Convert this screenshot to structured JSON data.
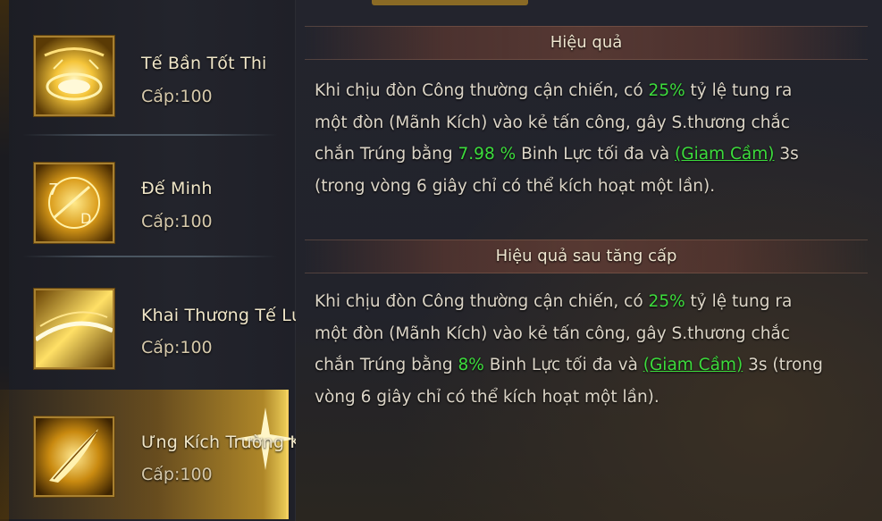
{
  "skills": [
    {
      "name": "Tế Bần Tốt Thi",
      "level": "Cấp:100",
      "icon": "golden-vortex-icon"
    },
    {
      "name": "Đế Minh",
      "level": "Cấp:100",
      "icon": "golden-runes-icon"
    },
    {
      "name": "Khai Thương Tế Lương",
      "level": "Cấp:100",
      "icon": "golden-light-icon"
    },
    {
      "name": "Ưng Kích Trường Không",
      "level": "Cấp:100",
      "icon": "golden-feather-icon",
      "selected": true
    }
  ],
  "effect": {
    "title": "Hiệu quả",
    "p1": "Khi chịu đòn Công thường cận chiến, có ",
    "v1": "25%",
    "p2": " tỷ lệ tung ra một đòn (Mãnh Kích) vào kẻ tấn công, gây S.thương chắc chắn Trúng bằng ",
    "v2": "7.98 %",
    "p3": " Binh Lực tối đa và ",
    "link": "(Giam Cầm)",
    "p4": " 3s (trong vòng 6 giây chỉ có thể kích hoạt một lần)."
  },
  "upgrade": {
    "title": "Hiệu quả sau tăng cấp",
    "p1": "Khi chịu đòn Công thường cận chiến, có ",
    "v1": "25%",
    "p2": " tỷ lệ tung ra một đòn (Mãnh Kích) vào kẻ tấn công, gây S.thương chắc chắn Trúng bằng ",
    "v2": "8%",
    "p3": " Binh Lực tối đa và ",
    "link": "(Giam Cầm)",
    "p4": " 3s (trong vòng 6 giây chỉ có thể kích hoạt một lần)."
  },
  "colors": {
    "accent_green": "#3cdc3c",
    "gold_border": "#a8802f"
  }
}
